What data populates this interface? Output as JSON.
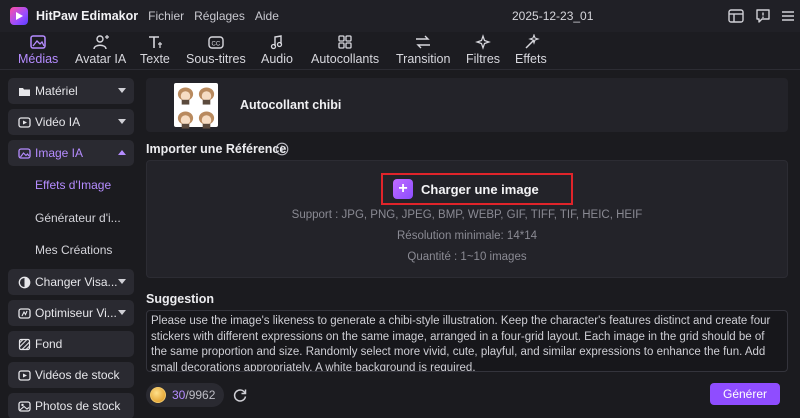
{
  "app": {
    "title": "HitPaw Edimakor",
    "project_name": "2025-12-23_01",
    "menu": [
      "Fichier",
      "Réglages",
      "Aide"
    ]
  },
  "toolbar": {
    "tabs": [
      {
        "label": "Médias",
        "icon": "media-icon",
        "active": true
      },
      {
        "label": "Avatar IA",
        "icon": "avatar-ai-icon",
        "active": false
      },
      {
        "label": "Texte",
        "icon": "text-icon",
        "active": false
      },
      {
        "label": "Sous-titres",
        "icon": "subtitles-icon",
        "active": false
      },
      {
        "label": "Audio",
        "icon": "audio-icon",
        "active": false
      },
      {
        "label": "Autocollants",
        "icon": "stickers-icon",
        "active": false
      },
      {
        "label": "Transition",
        "icon": "transition-icon",
        "active": false
      },
      {
        "label": "Filtres",
        "icon": "filters-icon",
        "active": false
      },
      {
        "label": "Effets",
        "icon": "effects-icon",
        "active": false
      }
    ]
  },
  "sidebar": {
    "categories": [
      {
        "label": "Matériel",
        "icon": "folder-icon",
        "expanded": false
      },
      {
        "label": "Vidéo IA",
        "icon": "video-ai-icon",
        "expanded": false
      },
      {
        "label": "Image IA",
        "icon": "image-ai-icon",
        "expanded": true
      },
      {
        "label": "Changer Visa...",
        "icon": "face-swap-icon",
        "expanded": false
      },
      {
        "label": "Optimiseur Vi...",
        "icon": "video-enhancer-icon",
        "expanded": false
      },
      {
        "label": "Fond",
        "icon": "background-icon",
        "expanded": false
      },
      {
        "label": "Vidéos de stock",
        "icon": "stock-video-icon",
        "expanded": false
      },
      {
        "label": "Photos de stock",
        "icon": "stock-photo-icon",
        "expanded": false
      }
    ],
    "subitems": [
      {
        "label": "Effets d'Image",
        "active": true
      },
      {
        "label": "Générateur d'i...",
        "active": false
      },
      {
        "label": "Mes Créations",
        "active": false
      }
    ]
  },
  "main": {
    "sticker_label": "Autocollant chibi",
    "import_title": "Importer une Référence",
    "upload_button_label": "Charger une image",
    "upload_support": "Support : JPG, PNG, JPEG, BMP, WEBP, GIF, TIFF, TIF, HEIC, HEIF",
    "upload_resolution": "Résolution minimale: 14*14",
    "upload_quantity": "Quantité : 1~10 images",
    "suggestion_title": "Suggestion",
    "suggestion_text": "Please use the image's likeness to generate a chibi-style illustration. Keep the character's features distinct and create four stickers with different expressions on the same image, arranged in a four-grid layout. Each image in the grid should be of the same proportion and size. Randomly select more vivid, cute, playful, and similar expressions to enhance the fun. Add small decorations appropriately. A white background is required.",
    "credits_used": "30",
    "credits_total": "/9962",
    "generate_label": "Générer"
  },
  "colors": {
    "accent": "#b58cff",
    "button": "#8f4dff",
    "highlight_frame": "#e0242a"
  }
}
